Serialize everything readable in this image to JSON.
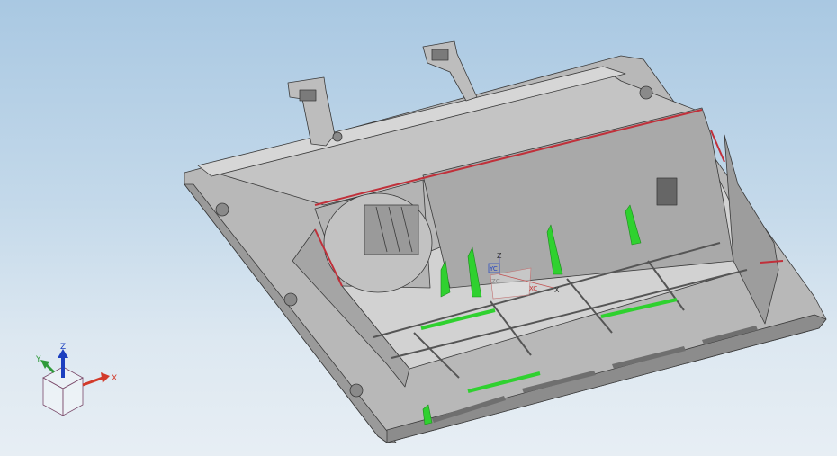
{
  "app": {
    "view": "cad-3d-viewport"
  },
  "colors": {
    "background_top": "#a9c8e2",
    "background_bottom": "#e7eef4",
    "part_light": "#c9c9c9",
    "part_mid": "#a8a8a8",
    "part_dark": "#8a8a8a",
    "edge": "#3a3a3a",
    "highlight_green": "#2fd12f",
    "highlight_red": "#c0303a",
    "axis_x": "#d23a2a",
    "axis_y": "#2f9a3a",
    "axis_z": "#1c3fbf"
  },
  "triad": {
    "x_label": "X",
    "y_label": "Y",
    "z_label": "Z",
    "x_icon": "x-axis-arrow-icon",
    "y_icon": "y-axis-arrow-icon",
    "z_icon": "z-axis-arrow-icon",
    "cube_icon": "view-cube-icon"
  },
  "wcs": {
    "z_label": "Z",
    "x_label": "X",
    "ycs_label": "YC",
    "xcs_label": "XC",
    "zcs_label": "ZC"
  },
  "model": {
    "icon": "plastic-housing-part-icon",
    "tabs": 2,
    "green_ribs": 5,
    "green_strips": 3
  }
}
